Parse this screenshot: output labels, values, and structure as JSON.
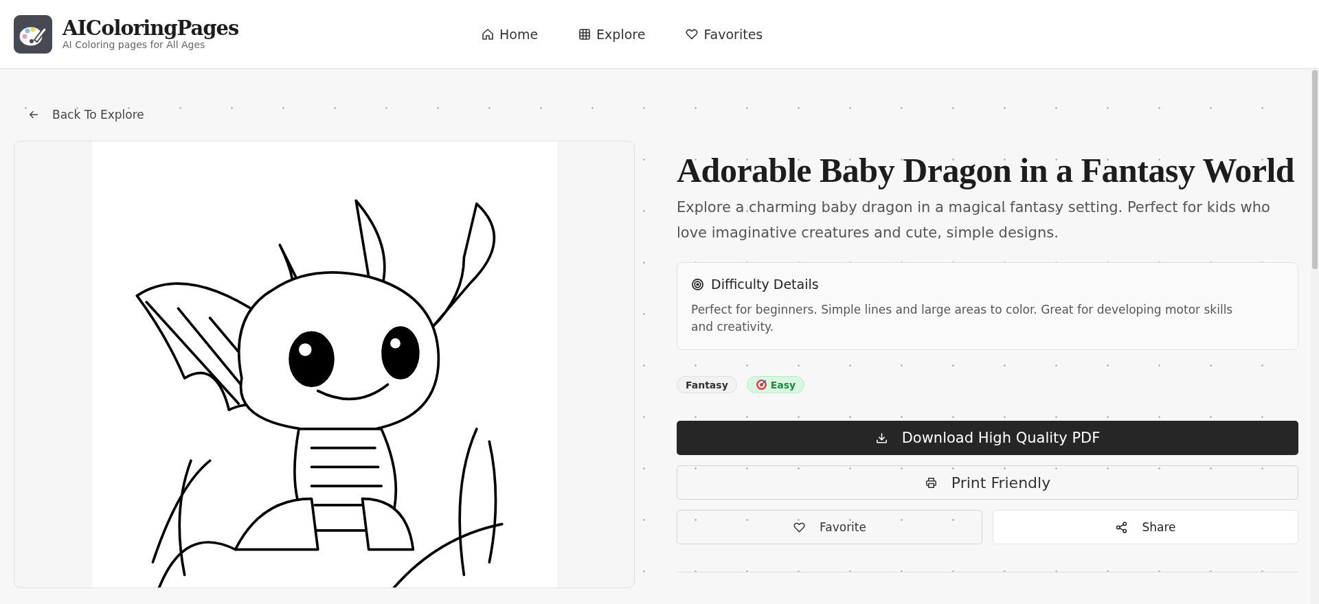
{
  "header": {
    "logo_title": "AIColoringPages",
    "logo_subtitle": "AI Coloring pages for All Ages",
    "nav": [
      {
        "label": "Home"
      },
      {
        "label": "Explore"
      },
      {
        "label": "Favorites"
      }
    ]
  },
  "back_link": "Back To Explore",
  "detail": {
    "title": "Adorable Baby Dragon in a Fantasy World",
    "description": "Explore a charming baby dragon in a magical fantasy setting. Perfect for kids who love imaginative creatures and cute, simple designs.",
    "difficulty_card": {
      "heading": "Difficulty Details",
      "text": "Perfect for beginners. Simple lines and large areas to color. Great for developing motor skills and creativity."
    },
    "tags": [
      {
        "label": "Fantasy",
        "kind": "category"
      },
      {
        "label": "Easy",
        "kind": "difficulty"
      }
    ],
    "buttons": [
      {
        "label": "Download High Quality PDF",
        "kind": "download"
      },
      {
        "label": "Print Friendly",
        "kind": "print"
      },
      {
        "label": "Favorite",
        "kind": "favorite"
      },
      {
        "label": "Share",
        "kind": "share"
      }
    ]
  }
}
